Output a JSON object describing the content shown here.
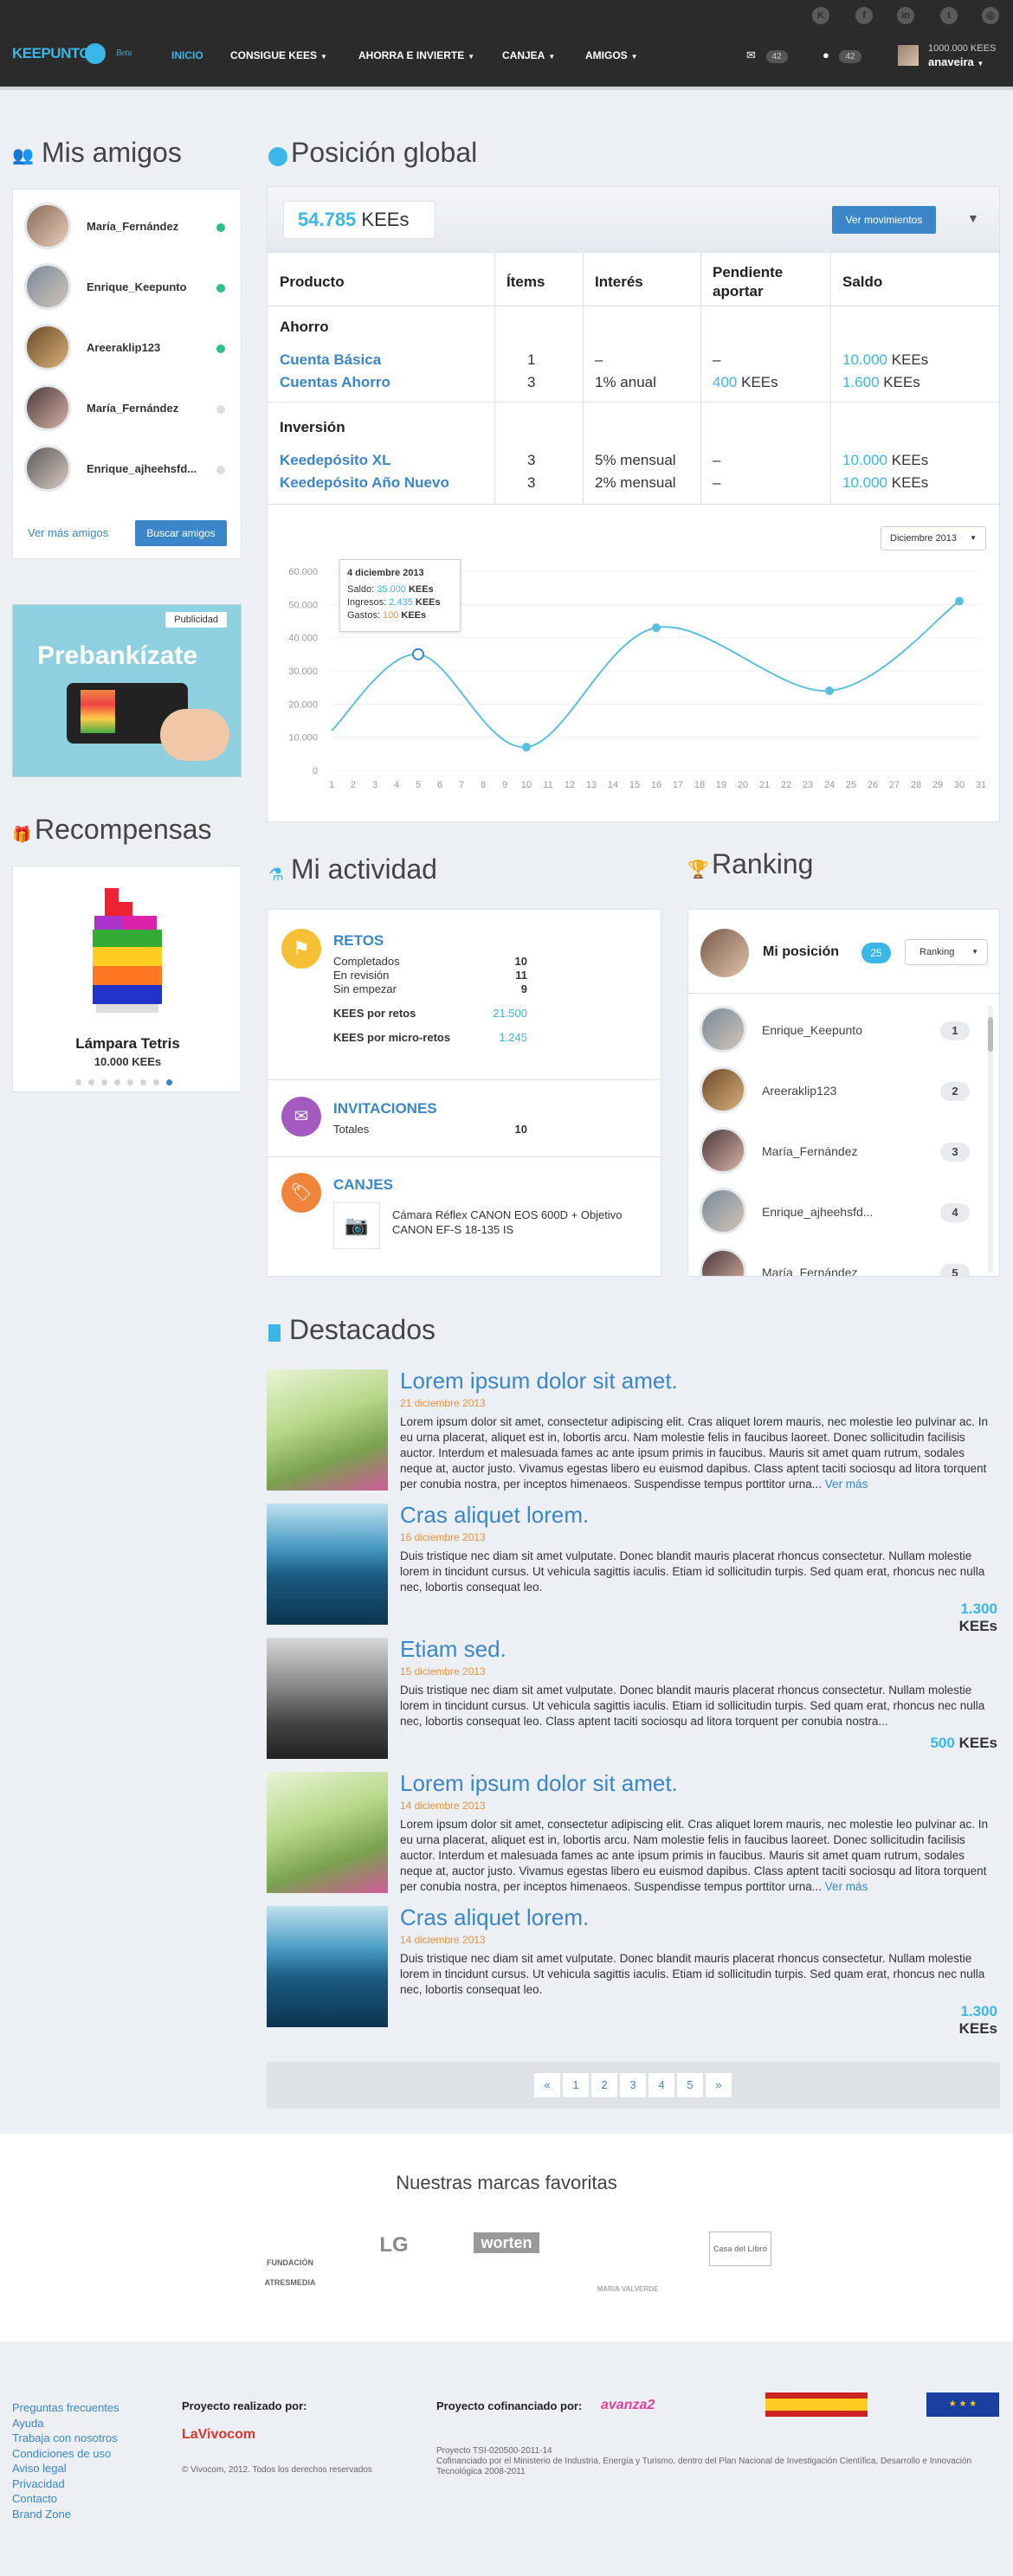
{
  "header": {
    "logo": "KEEPUNTO",
    "beta": "Beta",
    "social_icons": [
      "k-icon",
      "facebook-icon",
      "linkedin-icon",
      "twitter-icon",
      "instagram-icon"
    ],
    "nav": [
      {
        "label": "INICIO",
        "active": true
      },
      {
        "label": "CONSIGUE KEES",
        "dropdown": true
      },
      {
        "label": "AHORRA E INVIERTE",
        "dropdown": true
      },
      {
        "label": "CANJEA",
        "dropdown": true
      },
      {
        "label": "AMIGOS",
        "dropdown": true
      }
    ],
    "messages_count": "42",
    "notifications_count": "42",
    "user_kees": "1000.000 KEES",
    "username": "anaveira"
  },
  "friends": {
    "title": "Mis amigos",
    "items": [
      {
        "name": "María_Fernández",
        "online": true
      },
      {
        "name": "Enrique_Keepunto",
        "online": true
      },
      {
        "name": "Areeraklip123",
        "online": true
      },
      {
        "name": "María_Fernández",
        "online": false
      },
      {
        "name": "Enrique_ajheehsfd...",
        "online": false
      }
    ],
    "more_link": "Ver más amigos",
    "search_button": "Buscar amigos"
  },
  "ad": {
    "badge": "Publicidad",
    "text": "Prebankízate"
  },
  "rewards": {
    "title": "Recompensas",
    "item_name": "Lámpara Tetris",
    "item_price": "10.000 KEEs",
    "dots": 8,
    "active_dot": 7
  },
  "global": {
    "title": "Posición global",
    "total_value": "54.785",
    "total_unit": "KEEs",
    "movements_button": "Ver movimientos",
    "columns": [
      "Producto",
      "Ítems",
      "Interés",
      "Pendiente aportar",
      "Saldo"
    ],
    "groups": [
      {
        "name": "Ahorro",
        "rows": [
          {
            "product": "Cuenta Básica",
            "items": "1",
            "interest": "–",
            "pending": "–",
            "pending_unit": "",
            "saldo": "10.000",
            "unit": "KEEs"
          },
          {
            "product": "Cuentas Ahorro",
            "items": "3",
            "interest": "1% anual",
            "pending": "400",
            "pending_unit": "KEEs",
            "saldo": "1.600",
            "unit": "KEEs"
          }
        ]
      },
      {
        "name": "Inversión",
        "rows": [
          {
            "product": "Keedepósito XL",
            "items": "3",
            "interest": "5% mensual",
            "pending": "–",
            "pending_unit": "",
            "saldo": "10.000",
            "unit": "KEEs"
          },
          {
            "product": "Keedepósito Año Nuevo",
            "items": "3",
            "interest": "2% mensual",
            "pending": "–",
            "pending_unit": "",
            "saldo": "10.000",
            "unit": "KEEs"
          }
        ]
      }
    ],
    "period_select": "Diciembre 2013",
    "tooltip": {
      "date": "4 diciembre 2013",
      "saldo_label": "Saldo:",
      "saldo": "35.000",
      "saldo_unit": "KEEs",
      "ingresos_label": "Ingresos:",
      "ingresos": "2.435",
      "ingresos_unit": "KEEs",
      "gastos_label": "Gastos:",
      "gastos": "100",
      "gastos_unit": "KEEs"
    }
  },
  "chart_data": {
    "type": "line",
    "x": [
      1,
      5,
      10,
      16,
      24,
      30
    ],
    "values": [
      12000,
      35000,
      7000,
      43000,
      24000,
      51000
    ],
    "x_ticks": [
      "1",
      "2",
      "3",
      "4",
      "5",
      "6",
      "7",
      "8",
      "9",
      "10",
      "11",
      "12",
      "13",
      "14",
      "15",
      "16",
      "17",
      "18",
      "19",
      "20",
      "21",
      "22",
      "23",
      "24",
      "25",
      "26",
      "27",
      "28",
      "29",
      "30",
      "31"
    ],
    "y_ticks": [
      "60.000",
      "50.000",
      "40.000",
      "30.000",
      "20.000",
      "10.000",
      "0"
    ],
    "ylim": [
      0,
      60000
    ],
    "xlim": [
      1,
      31
    ],
    "grid": true,
    "color": "#5bc0de"
  },
  "activity": {
    "title": "Mi actividad",
    "retos": {
      "title": "RETOS",
      "rows": [
        {
          "label": "Completados",
          "value": "10"
        },
        {
          "label": "En revisión",
          "value": "11"
        },
        {
          "label": "Sin empezar",
          "value": "9"
        }
      ],
      "kees_retos_label": "KEES por retos",
      "kees_retos": "21.500",
      "kees_micro_label": "KEES por micro-retos",
      "kees_micro": "1.245"
    },
    "invitaciones": {
      "title": "INVITACIONES",
      "label": "Totales",
      "value": "10"
    },
    "canjes": {
      "title": "CANJES",
      "item": "Cámara Réflex CANON EOS 600D + Objetivo CANON EF-S 18-135 IS"
    }
  },
  "ranking": {
    "title": "Ranking",
    "my_position_label": "Mi posición",
    "my_position": "25",
    "select": "Ranking",
    "items": [
      {
        "name": "Enrique_Keepunto",
        "pos": "1"
      },
      {
        "name": "Areeraklip123",
        "pos": "2"
      },
      {
        "name": "María_Fernández",
        "pos": "3"
      },
      {
        "name": "Enrique_ajheehsfd...",
        "pos": "4"
      },
      {
        "name": "María_Fernández",
        "pos": "5"
      }
    ]
  },
  "featured": {
    "title": "Destacados",
    "more_label": "Ver más",
    "items": [
      {
        "title": "Lorem ipsum dolor sit amet.",
        "date": "21 diciembre 2013",
        "text": "Lorem ipsum dolor sit amet, consectetur adipiscing elit. Cras aliquet lorem mauris, nec molestie leo pulvinar ac. In eu urna placerat, aliquet est in, lobortis arcu. Nam molestie felis in faucibus laoreet. Donec sollicitudin facilisis auctor. Interdum et malesuada fames ac ante ipsum primis in faucibus. Mauris sit amet quam rutrum, sodales neque at, auctor justo. Vivamus egestas libero eu euismod dapibus. Class aptent taciti sociosqu ad litora torquent per conubia nostra, per inceptos himenaeos. Suspendisse tempus porttitor urna...",
        "kees": "",
        "image": "flower"
      },
      {
        "title": "Cras aliquet lorem.",
        "date": "16 diciembre 2013",
        "text": "Duis tristique nec diam sit amet vulputate. Donec blandit mauris placerat rhoncus consectetur. Nullam molestie lorem in tincidunt cursus. Ut vehicula sagittis iaculis. Etiam id sollicitudin turpis. Sed quam erat, rhoncus nec nulla nec, lobortis consequat leo.",
        "kees": "1.300",
        "image": "sea"
      },
      {
        "title": "Etiam sed.",
        "date": "15 diciembre 2013",
        "text": "Duis tristique nec diam sit amet vulputate. Donec blandit mauris placerat rhoncus consectetur. Nullam molestie lorem in tincidunt cursus. Ut vehicula sagittis iaculis. Etiam id sollicitudin turpis. Sed quam erat, rhoncus nec nulla nec, lobortis consequat leo. Class aptent taciti sociosqu ad litora torquent per conubia nostra...",
        "kees": "500",
        "image": "road"
      },
      {
        "title": "Lorem ipsum dolor sit amet.",
        "date": "14 diciembre 2013",
        "text": "Lorem ipsum dolor sit amet, consectetur adipiscing elit. Cras aliquet lorem mauris, nec molestie leo pulvinar ac. In eu urna placerat, aliquet est in, lobortis arcu. Nam molestie felis in faucibus laoreet. Donec sollicitudin facilisis auctor. Interdum et malesuada fames ac ante ipsum primis in faucibus. Mauris sit amet quam rutrum, sodales neque at, auctor justo. Vivamus egestas libero eu euismod dapibus. Class aptent taciti sociosqu ad litora torquent per conubia nostra, per inceptos himenaeos. Suspendisse tempus porttitor urna...",
        "kees": "",
        "image": "flower"
      },
      {
        "title": "Cras aliquet lorem.",
        "date": "14 diciembre 2013",
        "text": "Duis tristique nec diam sit amet vulputate. Donec blandit mauris placerat rhoncus consectetur. Nullam molestie lorem in tincidunt cursus. Ut vehicula sagittis iaculis. Etiam id sollicitudin turpis. Sed quam erat, rhoncus nec nulla nec, lobortis consequat leo.",
        "kees": "1.300",
        "image": "sea"
      }
    ],
    "kees_unit": "KEEs",
    "pagination": [
      "«",
      "1",
      "2",
      "3",
      "4",
      "5",
      "»"
    ]
  },
  "brands": {
    "title": "Nuestras marcas favoritas",
    "items": [
      "FUNDACIÓN ATRESMEDIA",
      "LG",
      "worten",
      "MARIA VALVERDE",
      "Casa del Libro"
    ]
  },
  "footer": {
    "links": [
      "Preguntas frecuentes",
      "Ayuda",
      "Trabaja con nosotros",
      "Condiciones de uso",
      "Aviso legal",
      "Privacidad",
      "Contacto",
      "Brand Zone"
    ],
    "realizado_label": "Proyecto realizado por:",
    "realizado_brand": "LaVivocom",
    "copyright": "© Vivocom, 2012. Todos los derechos reservados",
    "cofinanciado_label": "Proyecto cofinanciado por:",
    "plan_brand": "avanza2",
    "project_code": "Proyecto TSI-020500-2011-14",
    "cofin_text": "Cofinanciado por el Ministerio de Industria, Energía y Turismo, dentro del Plan Nacional de Investigación Científica, Desarrollo e Innovación Tecnológica 2008-2011"
  }
}
